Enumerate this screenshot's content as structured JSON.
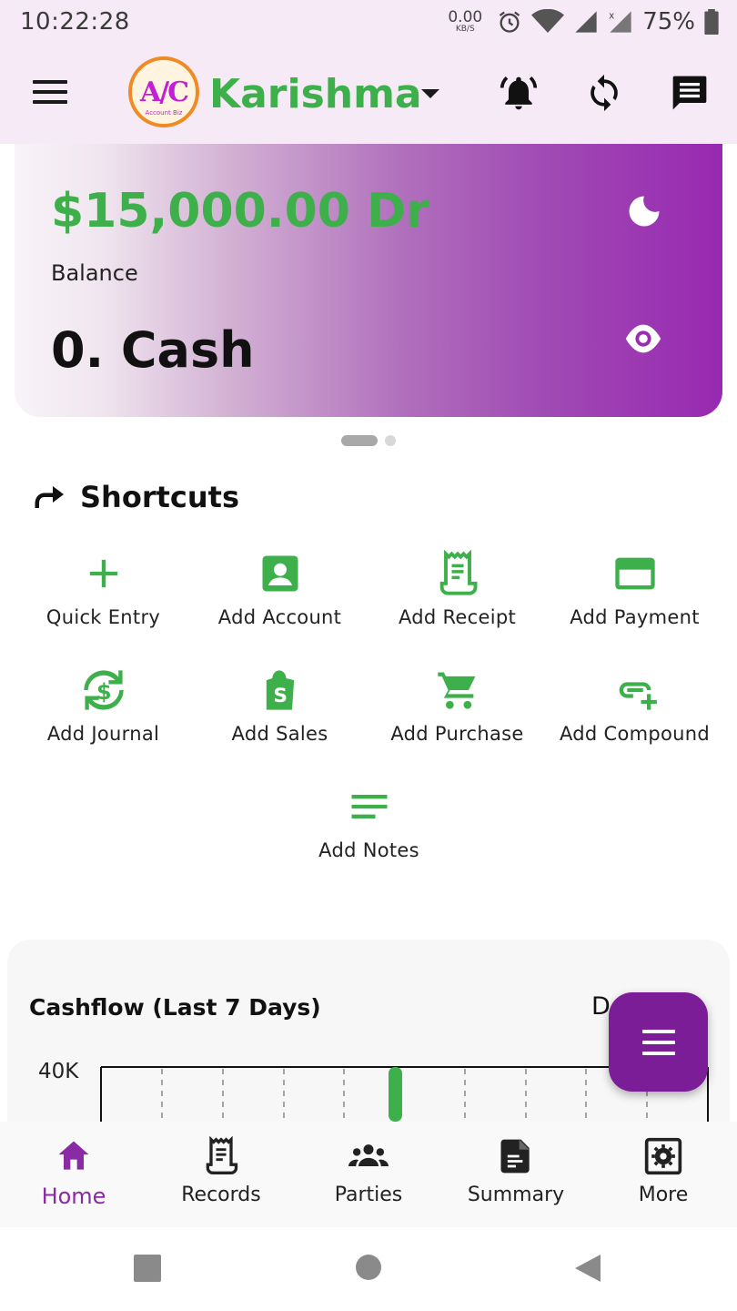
{
  "status_bar": {
    "time": "10:22:28",
    "net_speed_value": "0.00",
    "net_speed_unit": "KB/S",
    "battery": "75%"
  },
  "app_bar": {
    "logo_text": "A/C",
    "logo_subtext": "Account Biz",
    "company_name": "Karishma"
  },
  "balance_card": {
    "amount": "$15,000.00 Dr",
    "label": "Balance",
    "account_name": "0. Cash"
  },
  "shortcuts": {
    "title": "Shortcuts",
    "items": [
      {
        "label": "Quick Entry",
        "icon": "plus-icon"
      },
      {
        "label": "Add Account",
        "icon": "account-box-icon"
      },
      {
        "label": "Add Receipt",
        "icon": "receipt-icon"
      },
      {
        "label": "Add Payment",
        "icon": "credit-card-icon"
      },
      {
        "label": "Add Journal",
        "icon": "currency-exchange-icon"
      },
      {
        "label": "Add Sales",
        "icon": "shopping-bag-icon"
      },
      {
        "label": "Add Purchase",
        "icon": "cart-icon"
      },
      {
        "label": "Add Compound",
        "icon": "add-link-icon"
      },
      {
        "label": "Add Notes",
        "icon": "notes-icon"
      }
    ]
  },
  "cashflow": {
    "title": "Cashflow (Last 7 Days)",
    "right_label": "D",
    "y_tick": "40K"
  },
  "chart_data": {
    "type": "bar",
    "title": "Cashflow (Last 7 Days)",
    "yticks": [
      "40K"
    ],
    "note": ""
  },
  "bottom_nav": {
    "items": [
      {
        "label": "Home",
        "icon": "home-icon",
        "active": true
      },
      {
        "label": "Records",
        "icon": "records-icon",
        "active": false
      },
      {
        "label": "Parties",
        "icon": "people-icon",
        "active": false
      },
      {
        "label": "Summary",
        "icon": "summary-icon",
        "active": false
      },
      {
        "label": "More",
        "icon": "settings-icon",
        "active": false
      }
    ]
  },
  "colors": {
    "accent_green": "#3db04b",
    "accent_purple": "#8a2aa4",
    "fab_purple": "#7a1d96",
    "header_bg": "#f6eaf6"
  }
}
